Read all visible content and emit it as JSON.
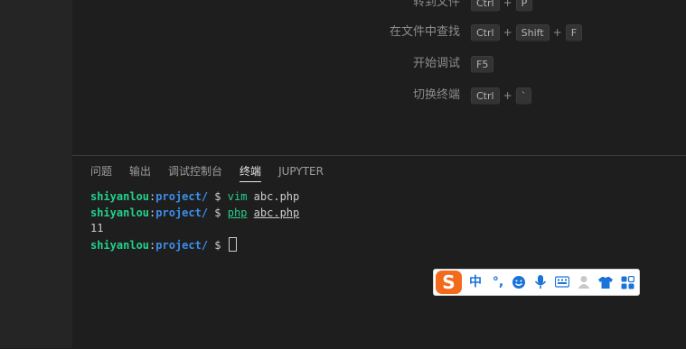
{
  "shortcuts": [
    {
      "label": "转到文件",
      "keys": [
        "Ctrl",
        "P"
      ]
    },
    {
      "label": "在文件中查找",
      "keys": [
        "Ctrl",
        "Shift",
        "F"
      ]
    },
    {
      "label": "开始调试",
      "keys": [
        "F5"
      ]
    },
    {
      "label": "切换终端",
      "keys": [
        "Ctrl",
        "`"
      ]
    }
  ],
  "panel": {
    "tabs": [
      {
        "label": "问题"
      },
      {
        "label": "输出"
      },
      {
        "label": "调试控制台"
      },
      {
        "label": "终端"
      },
      {
        "label": "JUPYTER"
      }
    ],
    "active_tab": "终端"
  },
  "terminal": {
    "user": "shiyanlou",
    "colon": ":",
    "path": "project/",
    "prompt": " $ ",
    "lines": [
      {
        "cmd": "vim",
        "arg": "abc.php"
      },
      {
        "cmd": "php",
        "arg": "abc.php"
      }
    ],
    "output": "11"
  },
  "ime_toolbar": {
    "logo": "S",
    "mode": "中",
    "punct": "°,",
    "icons": [
      "emoji-icon",
      "microphone-icon",
      "keyboard-icon",
      "user-icon",
      "skin-icon",
      "toolbox-icon"
    ],
    "accent": "#1a73d9",
    "logo_color": "#f26a1b"
  },
  "colors": {
    "background": "#1e1e1e",
    "terminal_user": "#23d18b",
    "terminal_path": "#3b8eea"
  }
}
